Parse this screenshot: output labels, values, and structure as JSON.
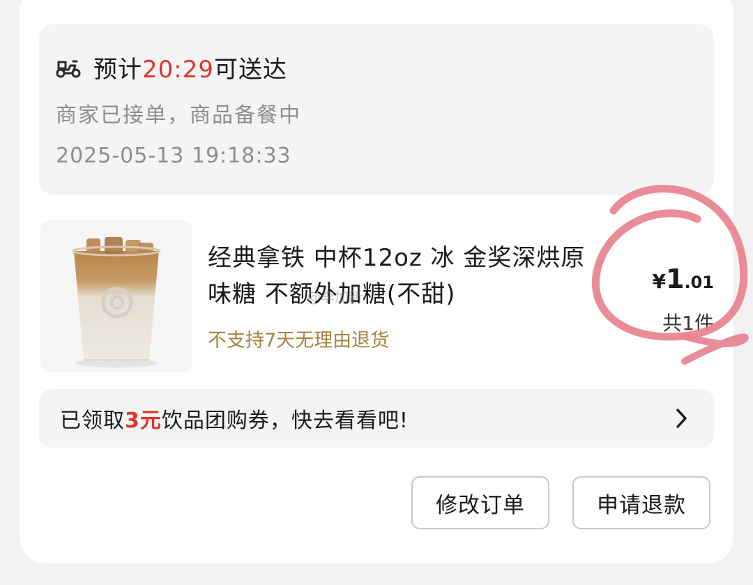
{
  "delivery": {
    "eta_prefix": "预计",
    "eta_time": "20:29",
    "eta_suffix": "可送达",
    "icon": "scooter-icon",
    "status": "商家已接单，商品备餐中",
    "timestamp": "2025-05-13 19:18:33"
  },
  "product": {
    "image_icon": "iced-latte-cup",
    "name": "经典拿铁 中杯12oz 冰 金奖深烘原味糖 不额外加糖(不甜)",
    "return_policy": "不支持7天无理由退货",
    "price_currency": "¥",
    "price_integer": "1",
    "price_decimal": ".01",
    "quantity": "共1件"
  },
  "watermark": "@李加新",
  "coupon": {
    "prefix": "已领取",
    "amount": "3元",
    "suffix": "饮品团购券，快去看看吧!",
    "icon": "chevron-right-icon"
  },
  "actions": {
    "modify_label": "修改订单",
    "refund_label": "申请退款"
  },
  "colors": {
    "accent_red": "#e0342b",
    "policy_gold": "#a7823f",
    "annotation_pink": "#e8828f"
  }
}
